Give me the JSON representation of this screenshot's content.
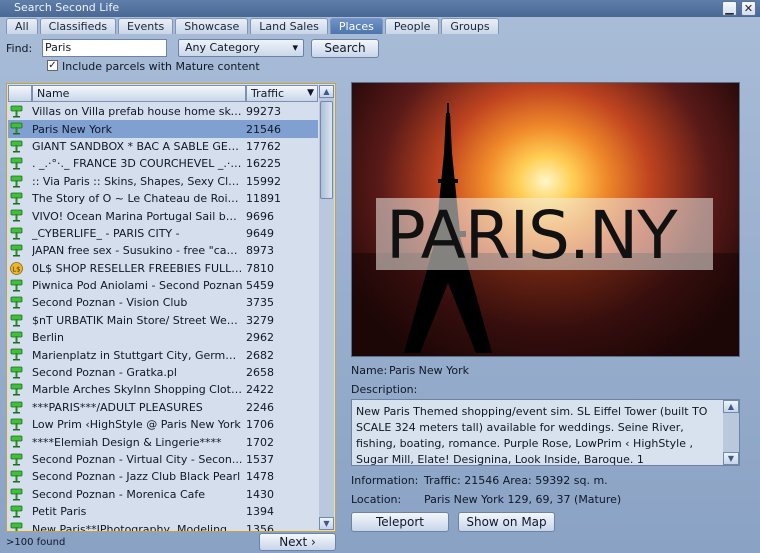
{
  "window": {
    "title": "Search Second Life",
    "minimize": "▁",
    "close": "✕"
  },
  "tabs": [
    {
      "label": "All"
    },
    {
      "label": "Classifieds"
    },
    {
      "label": "Events"
    },
    {
      "label": "Showcase"
    },
    {
      "label": "Land Sales"
    },
    {
      "label": "Places"
    },
    {
      "label": "People"
    },
    {
      "label": "Groups"
    }
  ],
  "active_tab": "Places",
  "search": {
    "find_label": "Find:",
    "query": "Paris",
    "category": "Any Category",
    "button_label": "Search",
    "mature_checked": true,
    "mature_label": "Include parcels with Mature content"
  },
  "results": {
    "columns": [
      "Name",
      "Traffic"
    ],
    "rows": [
      {
        "name": "Villas on Villa prefab house home sky...",
        "traffic": "99273",
        "icon": "pin"
      },
      {
        "name": "Paris New York",
        "traffic": "21546",
        "icon": "pin",
        "selected": true
      },
      {
        "name": "GIANT SANDBOX * BAC A SABLE GEANT ...",
        "traffic": "17762",
        "icon": "pin"
      },
      {
        "name": ". _.·°·._ FRANCE 3D COURCHEVEL _.·°·._",
        "traffic": "16225",
        "icon": "pin"
      },
      {
        "name": ":: Via Paris :: Skins, Shapes, Sexy Clot...",
        "traffic": "15992",
        "icon": "pin"
      },
      {
        "name": "The Story of O ~ Le Chateau de Roissy",
        "traffic": "11891",
        "icon": "pin"
      },
      {
        "name": "VIVO! Ocean Marina Portugal Sail boa...",
        "traffic": "9696",
        "icon": "pin"
      },
      {
        "name": "_CYBERLIFE_ - PARIS CITY -",
        "traffic": "9649",
        "icon": "pin"
      },
      {
        "name": "JAPAN free sex - Susukino - free \"cam...",
        "traffic": "8973",
        "icon": "pin"
      },
      {
        "name": "0L$ SHOP RESELLER FREEBIES FULL PE...",
        "traffic": "7810",
        "icon": "coin"
      },
      {
        "name": "Piwnica Pod Aniolami - Second Poznan",
        "traffic": "5459",
        "icon": "pin"
      },
      {
        "name": "Second Poznan - Vision Club",
        "traffic": "3735",
        "icon": "pin"
      },
      {
        "name": "$nT URBATIK Main Store/ Street Wea...",
        "traffic": "3279",
        "icon": "pin"
      },
      {
        "name": "Berlin",
        "traffic": "2962",
        "icon": "pin"
      },
      {
        "name": "Marienplatz in Stuttgart City, Germany",
        "traffic": "2682",
        "icon": "pin"
      },
      {
        "name": "Second Poznan - Gratka.pl",
        "traffic": "2658",
        "icon": "pin"
      },
      {
        "name": "Marble Arches SkyInn Shopping Cloth...",
        "traffic": "2422",
        "icon": "pin"
      },
      {
        "name": "***PARIS***/ADULT PLEASURES",
        "traffic": "2246",
        "icon": "pin"
      },
      {
        "name": "Low Prim ‹HighStyle @ Paris New York",
        "traffic": "1706",
        "icon": "pin"
      },
      {
        "name": "****Elemiah Design & Lingerie****",
        "traffic": "1702",
        "icon": "pin"
      },
      {
        "name": "Second Poznan - Virtual City - Secon...",
        "traffic": "1537",
        "icon": "pin"
      },
      {
        "name": "Second Poznan - Jazz Club Black Pearl",
        "traffic": "1478",
        "icon": "pin"
      },
      {
        "name": "Second Poznan - Morenica Cafe",
        "traffic": "1430",
        "icon": "pin"
      },
      {
        "name": "Petit Paris",
        "traffic": "1394",
        "icon": "pin"
      },
      {
        "name": "New Paris**IPhotography, Modeling...",
        "traffic": "1356",
        "icon": "pin"
      }
    ],
    "found_text": ">100 found",
    "next_label": "Next ›"
  },
  "details": {
    "snapshot_text": "PARIS.NY",
    "name_label": "Name:",
    "name_value": "Paris New York",
    "description_label": "Description:",
    "description": "New Paris Themed shopping/event sim. SL Eiffel Tower (built TO SCALE 324 meters tall) available for weddings. Seine River, fishing, boating, romance. Purple Rose, LowPrim ‹ HighStyle , Sugar Mill, Elate! Designina, Look Inside, Baroque. 1",
    "information_label": "Information:",
    "information_value": "Traffic: 21546 Area: 59392 sq. m.",
    "location_label": "Location:",
    "location_value": "Paris New York 129, 69, 37 (Mature)",
    "teleport_label": "Teleport",
    "show_on_map_label": "Show on Map"
  }
}
